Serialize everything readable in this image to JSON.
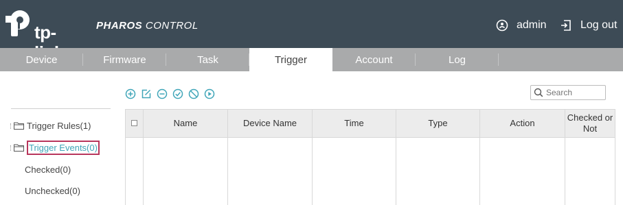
{
  "header": {
    "brand": "tp-link",
    "product_bold": "PHAROS",
    "product_rest": " CONTROL",
    "user_label": "admin",
    "logout_label": "Log out"
  },
  "nav": {
    "tabs": [
      {
        "label": "Device"
      },
      {
        "label": "Firmware"
      },
      {
        "label": "Task"
      },
      {
        "label": "Trigger",
        "active": true
      },
      {
        "label": "Account"
      },
      {
        "label": "Log"
      }
    ]
  },
  "sidebar": {
    "items": [
      {
        "label": "Trigger Rules(1)"
      },
      {
        "label": "Trigger Events(0)",
        "highlighted": true
      }
    ],
    "subitems": [
      {
        "label": "Checked(0)"
      },
      {
        "label": "Unchecked(0)"
      }
    ]
  },
  "toolbar": {
    "icons": [
      "add-icon",
      "edit-icon",
      "remove-icon",
      "check-icon",
      "block-icon",
      "play-icon"
    ],
    "accent": "#3fa5b8"
  },
  "search": {
    "placeholder": "Search"
  },
  "table": {
    "columns": [
      "Name",
      "Device Name",
      "Time",
      "Type",
      "Action",
      "Checked or Not"
    ],
    "rows": []
  },
  "colors": {
    "header_bg": "#3d4b56",
    "nav_bg": "#a9aaab",
    "highlight_border": "#b8365c",
    "link": "#3fa5b8"
  }
}
